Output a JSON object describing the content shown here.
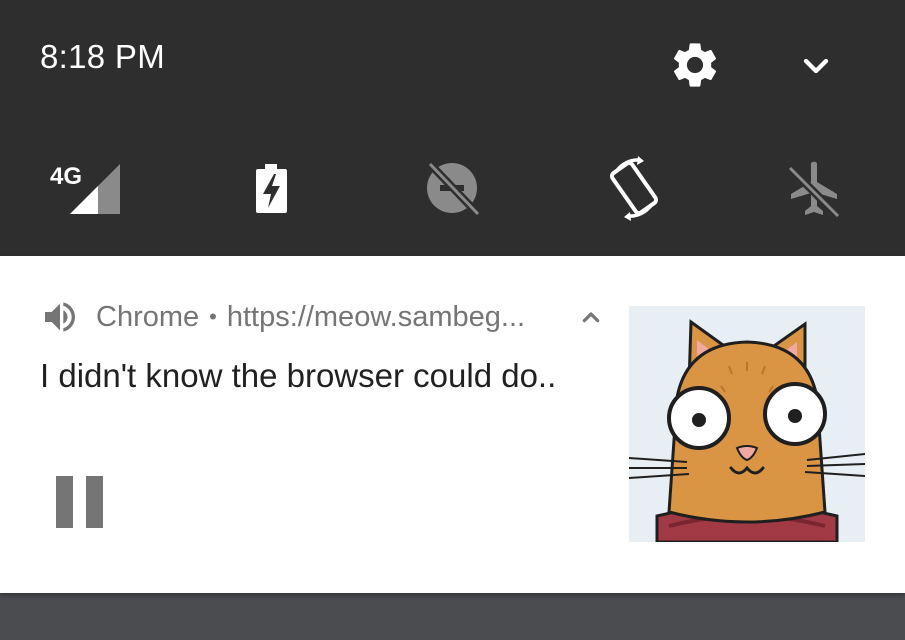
{
  "status": {
    "time": "8:18 PM"
  },
  "quick_settings": {
    "tiles": [
      {
        "icon": "signal-4g-icon",
        "label": "4G"
      },
      {
        "icon": "battery-charging-icon"
      },
      {
        "icon": "do-not-disturb-off-icon"
      },
      {
        "icon": "auto-rotate-icon"
      },
      {
        "icon": "airplane-mode-off-icon"
      }
    ]
  },
  "notification": {
    "app_name": "Chrome",
    "separator": "•",
    "url": "https://meow.sambeg...",
    "title": "I didn't know the browser could do..",
    "action": "pause",
    "colors": {
      "card_bg": "#ffffff",
      "shade_bg": "#2e2e2e",
      "secondary_text": "#757575",
      "primary_text": "#212121"
    }
  }
}
